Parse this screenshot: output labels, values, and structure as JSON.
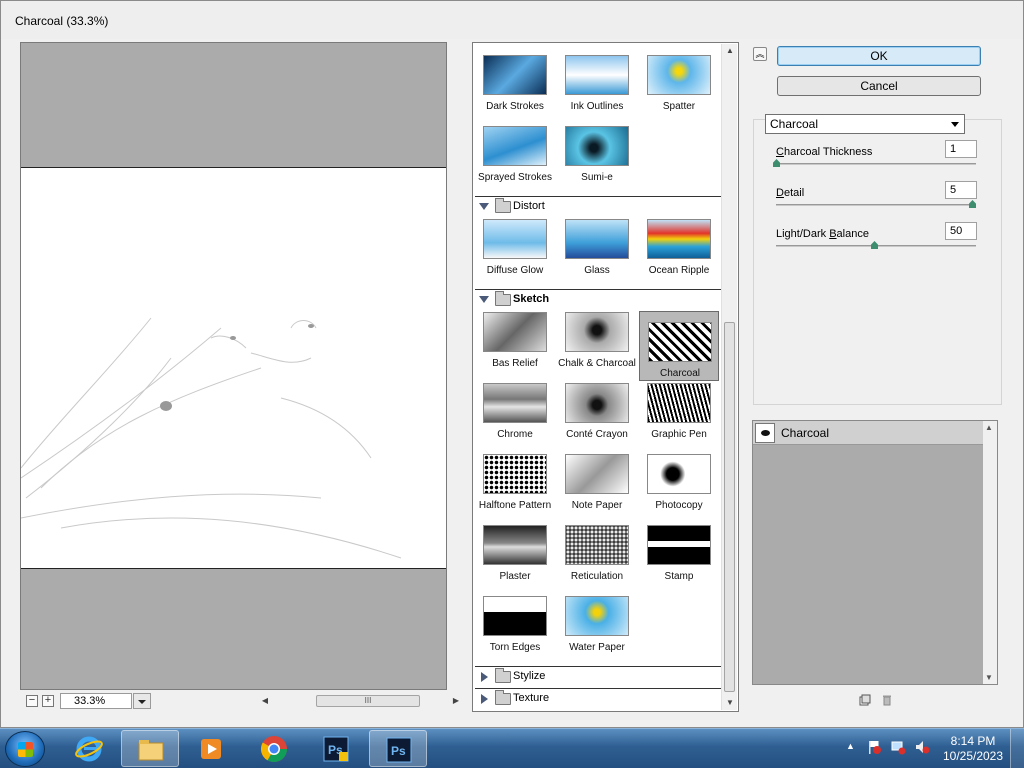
{
  "window": {
    "title": "Charcoal (33.3%)"
  },
  "preview": {
    "zoom": "33.3%",
    "zoom_out": "−",
    "zoom_in": "+",
    "scroll_left": "◀",
    "scroll_right": "▶",
    "scroll_thumb": "III"
  },
  "gallery": {
    "brush_strokes_items": [
      "Dark Strokes",
      "Ink Outlines",
      "Spatter",
      "Sprayed Strokes",
      "Sumi-e"
    ],
    "categories": {
      "distort": "Distort",
      "sketch": "Sketch",
      "stylize": "Stylize",
      "texture": "Texture"
    },
    "distort_items": [
      "Diffuse Glow",
      "Glass",
      "Ocean Ripple"
    ],
    "sketch_items": [
      "Bas Relief",
      "Chalk & Charcoal",
      "Charcoal",
      "Chrome",
      "Conté Crayon",
      "Graphic Pen",
      "Halftone Pattern",
      "Note Paper",
      "Photocopy",
      "Plaster",
      "Reticulation",
      "Stamp",
      "Torn Edges",
      "Water Paper"
    ],
    "selected": "Charcoal",
    "scroll_up": "▲",
    "scroll_down": "▼"
  },
  "controls": {
    "collapse": "︽",
    "ok": "OK",
    "cancel": "Cancel",
    "filter_select": "Charcoal",
    "params": [
      {
        "label": "Charcoal Thickness",
        "underline": "C",
        "rest": "harcoal Thickness",
        "value": "1",
        "fraction": 0.0
      },
      {
        "label": "Detail",
        "underline": "D",
        "rest": "etail",
        "value": "5",
        "fraction": 1.0
      },
      {
        "label": "Light/Dark Balance",
        "pre": "Light/Dark ",
        "underline": "B",
        "rest": "alance",
        "value": "50",
        "fraction": 0.5
      }
    ]
  },
  "layers": {
    "items": [
      {
        "name": "Charcoal",
        "visible": true
      }
    ],
    "scroll_up": "▲",
    "scroll_down": "▼"
  },
  "taskbar": {
    "apps": [
      "internet-explorer",
      "file-explorer",
      "media-player",
      "chrome",
      "photoshop-installer",
      "photoshop"
    ],
    "tray_arrow": "▲",
    "time": "8:14 PM",
    "date": "10/25/2023"
  }
}
